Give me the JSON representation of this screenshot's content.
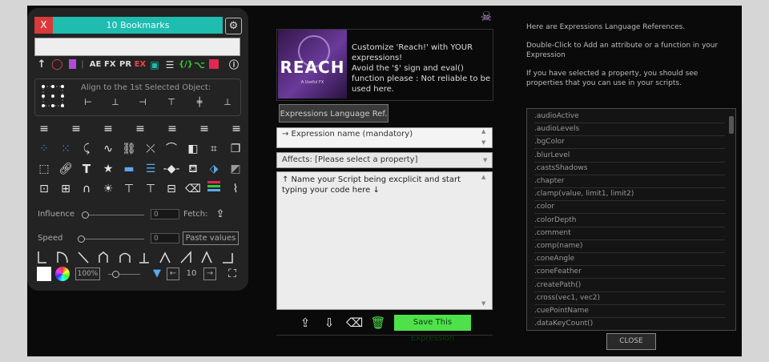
{
  "left_panel": {
    "close_label": "X",
    "bookmarks_label": "10 Bookmarks",
    "toolbar": {
      "fx_label": "FX",
      "pr_label": "PR",
      "ex_label": "EX",
      "brackets_label": "{/}",
      "ae_label": "AE"
    },
    "align_label": "Align to the 1st Selected Object:",
    "influence_label": "Influence",
    "influence_value": "0",
    "fetch_label": "Fetch:",
    "speed_label": "Speed",
    "speed_value": "0",
    "paste_values_label": "Paste values",
    "zoom_value": "100%",
    "step_value": "10",
    "text_tool_glyph": "T"
  },
  "middle": {
    "reach_logo": "REACH",
    "reach_sub": "A Useful FX",
    "reach_text": "Customize 'Reach!' with YOUR expressions!\nAvoid the '$' sign and eval() function please : Not reliable to be used here.",
    "ref_button_label": "Expressions Language Ref.",
    "expr_name_placeholder": "→ Expression name (mandatory)",
    "affects_label": "Affects: [Please select a property]",
    "code_placeholder": "↑ Name your Script being excplicit and start typing your code here ↓",
    "save_label": "Save This Expression"
  },
  "right": {
    "intro1": "Here are Expressions Language References.",
    "intro2": "Double-Click to Add an attribute or a function in your Expression",
    "intro3": "If you have selected a property, you should see properties that you can use in your scripts.",
    "refs": [
      ".audioActive",
      ".audioLevels",
      ".bgColor",
      ".blurLevel",
      ".castsShadows",
      ".chapter",
      ".clamp(value, limit1, limit2)",
      ".color",
      ".colorDepth",
      ".comment",
      ".comp(name)",
      ".coneAngle",
      ".coneFeather",
      ".createPath()",
      ".cross(vec1, vec2)",
      ".cuePointName",
      ".dataKeyCount()"
    ],
    "close_label": "CLOSE"
  },
  "colors": {
    "accent_teal": "#1fbcb0",
    "close_red": "#d8393b",
    "save_green": "#4ee14a",
    "skull_purple": "#c49ad8"
  }
}
